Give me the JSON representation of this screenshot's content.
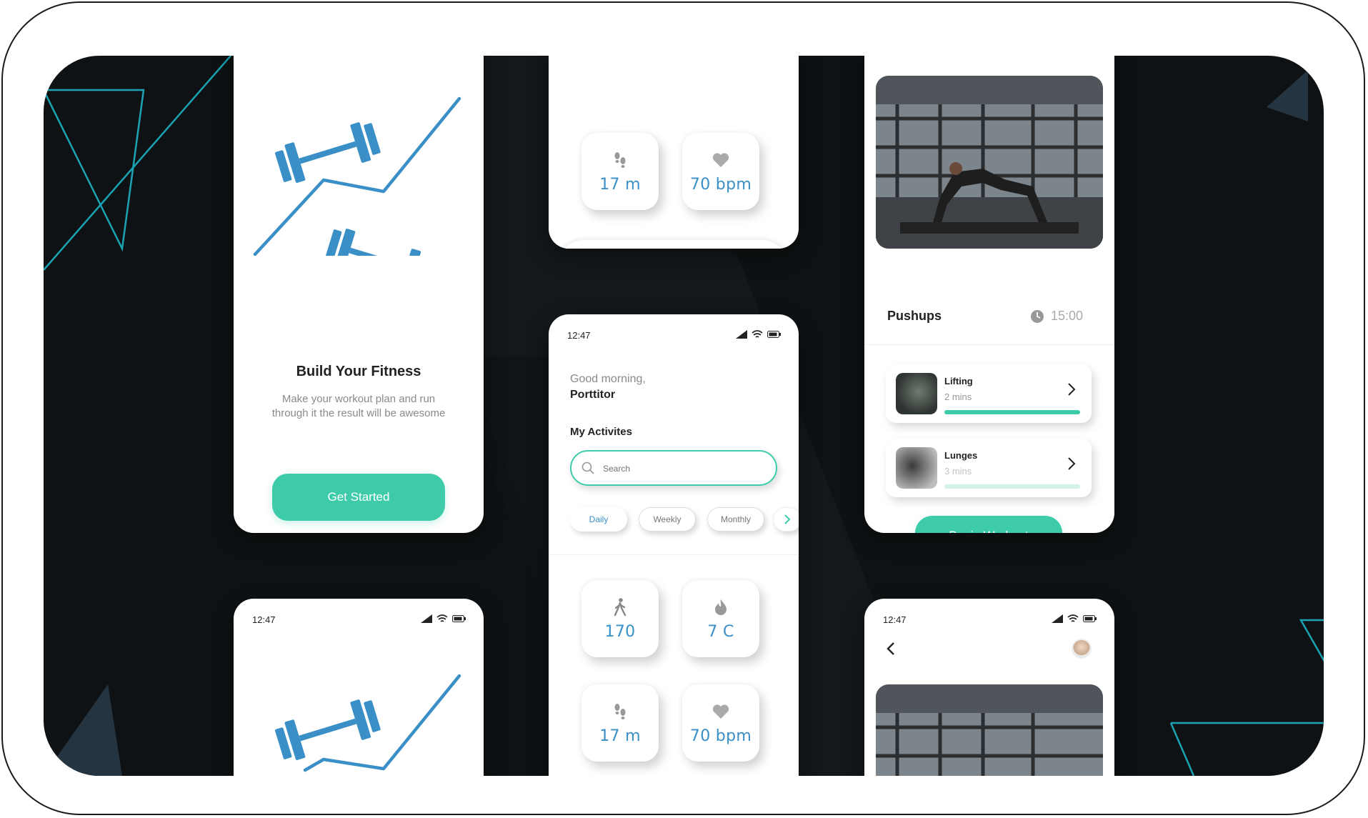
{
  "colors": {
    "accent_green": "#3ecbaa",
    "accent_blue": "#3a8fc7",
    "background_dark": "#0f1214",
    "teal_lines": "#1aa3b3"
  },
  "onboarding": {
    "title": "Build Your Fitness",
    "subtitle_line1": "Make your workout plan and run",
    "subtitle_line2": "through it the result will be awesome",
    "cta": "Get Started"
  },
  "status": {
    "time": "12:47"
  },
  "top_stats": [
    {
      "icon": "footsteps-icon",
      "value": "17 m"
    },
    {
      "icon": "heart-icon",
      "value": "70 bpm"
    }
  ],
  "bottom_nav": [
    "home-icon",
    "heart-icon",
    "calendar-icon",
    "profile-icon"
  ],
  "home": {
    "greeting": "Good morning,",
    "user_name": "Porttitor",
    "section_title": "My Activites",
    "search_placeholder": "Search",
    "tabs": [
      "Daily",
      "Weekly",
      "Monthly"
    ],
    "stats": [
      {
        "icon": "walking-icon",
        "value": "170"
      },
      {
        "icon": "flame-icon",
        "value": "7 C"
      },
      {
        "icon": "footsteps-icon",
        "value": "17 m"
      },
      {
        "icon": "heart-icon",
        "value": "70 bpm"
      }
    ]
  },
  "workout": {
    "title": "Pushups",
    "duration": "15:00",
    "exercises": [
      {
        "name": "Lifting",
        "duration": "2 mins",
        "progress": 1.0
      },
      {
        "name": "Lunges",
        "duration": "3 mins",
        "progress": 0.0
      }
    ],
    "cta": "Begin Workout"
  }
}
